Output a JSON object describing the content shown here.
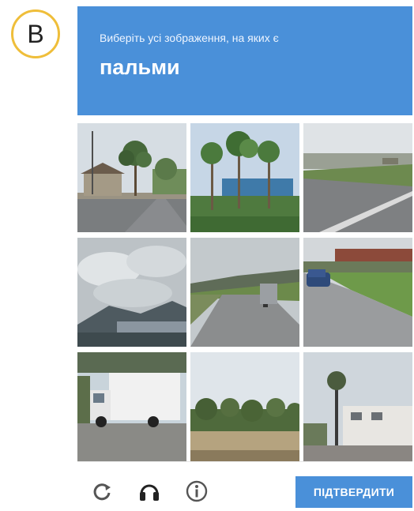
{
  "badge": {
    "letter": "В"
  },
  "captcha": {
    "instruction": "Виберіть усі зображення, на яких є",
    "object": "пальми",
    "verify_label": "ПІДТВЕРДИТИ",
    "accent_color": "#4a90d9",
    "icons": [
      "reload-icon",
      "audio-headphones-icon",
      "info-icon"
    ],
    "tiles": [
      {
        "index": 1,
        "content": "building-with-palm-trees-road"
      },
      {
        "index": 2,
        "content": "palm-trees-blue-building"
      },
      {
        "index": 3,
        "content": "highway-grass"
      },
      {
        "index": 4,
        "content": "cloudy-sky-mountains"
      },
      {
        "index": 5,
        "content": "road-truck-hills"
      },
      {
        "index": 6,
        "content": "parking-lot-blue-car"
      },
      {
        "index": 7,
        "content": "white-box-truck"
      },
      {
        "index": 8,
        "content": "trees-along-field"
      },
      {
        "index": 9,
        "content": "white-building-street"
      }
    ]
  }
}
